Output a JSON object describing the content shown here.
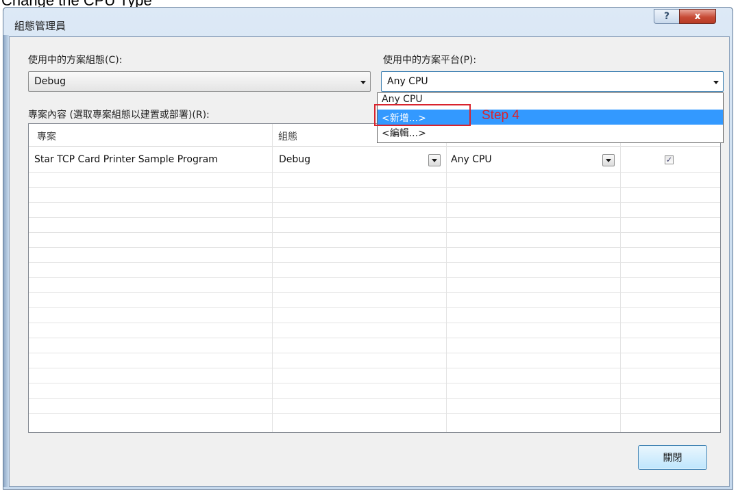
{
  "caption": "Change the CPU Type",
  "window": {
    "title": "組態管理員",
    "help_symbol": "?",
    "close_symbol": "x"
  },
  "config": {
    "label": "使用中的方案組態(C):",
    "value": "Debug"
  },
  "platform": {
    "label": "使用中的方案平台(P):",
    "value": "Any CPU",
    "options": [
      "Any CPU",
      "<新增...>",
      "<編輯...>"
    ],
    "highlighted_option": "<新增...>"
  },
  "project_contexts": {
    "label": "專案內容 (選取專案組態以建置或部署)(R):",
    "columns": [
      "專案",
      "組態"
    ],
    "rows": [
      {
        "project": "Star TCP Card Printer Sample Program",
        "configuration": "Debug",
        "platform": "Any CPU",
        "build": true
      }
    ]
  },
  "annotation": {
    "step": "Step 4",
    "color": "#d9232d"
  },
  "close_button": {
    "label": "關閉"
  },
  "colors": {
    "highlight": "#3399ff",
    "chrome": "#cfe0f1"
  }
}
